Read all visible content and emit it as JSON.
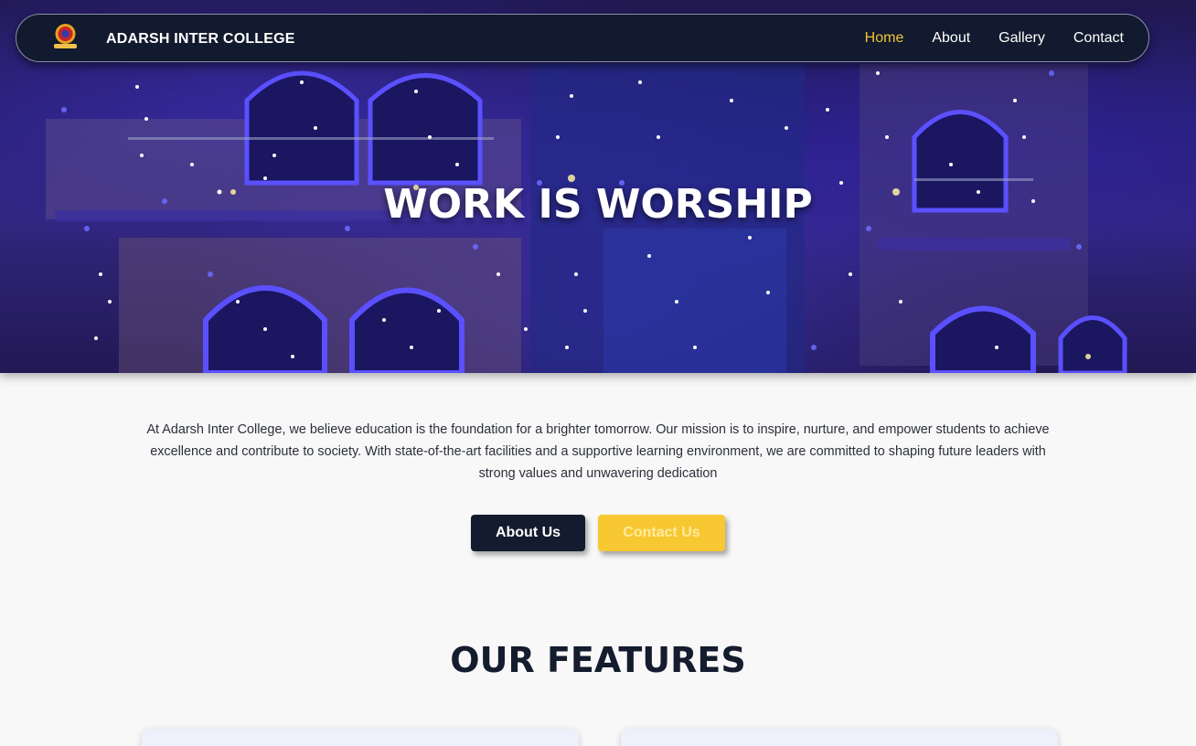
{
  "nav": {
    "brand": "ADARSH INTER COLLEGE",
    "logo_icon": "college-emblem-icon",
    "links": [
      {
        "label": "Home",
        "active": true
      },
      {
        "label": "About",
        "active": false
      },
      {
        "label": "Gallery",
        "active": false
      },
      {
        "label": "Contact",
        "active": false
      }
    ]
  },
  "hero": {
    "title": "WORK IS WORSHIP",
    "background": "college-building-lit-with-blue-lights"
  },
  "intro": {
    "text": "At Adarsh Inter College, we believe education is the foundation for a brighter tomorrow. Our mission is to inspire, nurture, and empower students to achieve excellence and contribute to society. With state-of-the-art facilities and a supportive learning environment, we are committed to shaping future leaders with strong values and unwavering dedication"
  },
  "buttons": {
    "about": "About Us",
    "contact": "Contact Us"
  },
  "features": {
    "title": "OUR FEATURES"
  },
  "colors": {
    "navy": "#111a2e",
    "accent_yellow": "#f7c431",
    "page_bg": "#f8f8f8"
  }
}
